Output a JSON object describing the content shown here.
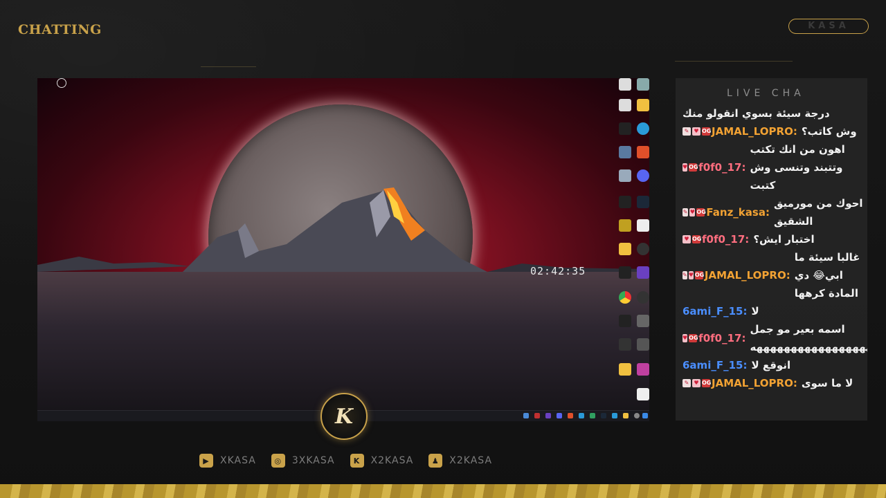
{
  "overlay": {
    "brand_top": "CHATTING",
    "brand_sub": "",
    "pill_label": "KASA",
    "chat_title": "LIVE CHA",
    "logo_letter": "K"
  },
  "desktop": {
    "clock": "02:42:35",
    "top_left_icon_label": "",
    "taskbar_time": ""
  },
  "socials": [
    {
      "icon": "youtube-icon",
      "label": "XKASA"
    },
    {
      "icon": "instagram-icon",
      "label": "3XKASA"
    },
    {
      "icon": "kick-icon",
      "label": "X2KASA"
    },
    {
      "icon": "snapchat-icon",
      "label": "X2KASA"
    }
  ],
  "chat": {
    "messages": [
      {
        "user": "",
        "badges": [],
        "text": "درجة سيئة بسوي انقولو منك"
      },
      {
        "user": "JAMAL_LOPRO",
        "badges": [
          "edit",
          "heart",
          "og"
        ],
        "text": "وش كاتب؟"
      },
      {
        "user": "f0f0_17",
        "badges": [
          "heart",
          "og"
        ],
        "text": "اهون من انك تكتب وتتبند وتنسى وش كتبت"
      },
      {
        "user": "Fanz_kasa",
        "badges": [
          "edit",
          "heart",
          "og"
        ],
        "text": "احوك من مورميق الشقيق"
      },
      {
        "user": "f0f0_17",
        "badges": [
          "heart",
          "og"
        ],
        "text": "اختبار ايش؟"
      },
      {
        "user": "JAMAL_LOPRO",
        "badges": [
          "edit",
          "heart",
          "og"
        ],
        "text": "غالبا سيئة ما ابي😂 دي المادة كرهها"
      },
      {
        "user": "6ami_F_15",
        "badges": [],
        "text": "لا"
      },
      {
        "user": "f0f0_17",
        "badges": [
          "heart",
          "og"
        ],
        "text": "اسمه بعير مو جمل ههههههههههههههههههههههههههههههههههههههههههههههه"
      },
      {
        "user": "6ami_F_15",
        "badges": [],
        "text": "انوقع لا"
      },
      {
        "user": "JAMAL_LOPRO",
        "badges": [
          "edit",
          "heart",
          "og"
        ],
        "text": "لا ما سوى"
      }
    ]
  },
  "colors": {
    "gold": "#c9a24a",
    "user_orange": "#f2a233",
    "user_pink": "#ff6e7f",
    "user_blue": "#4a8eff"
  }
}
